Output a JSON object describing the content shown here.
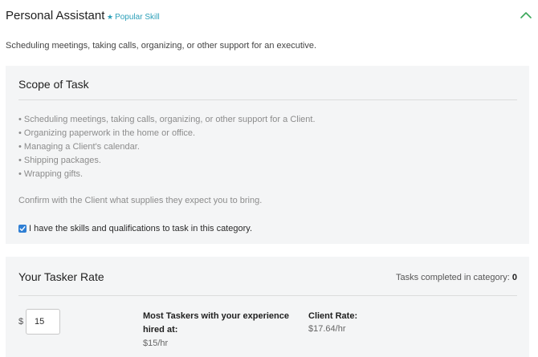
{
  "header": {
    "title": "Personal Assistant",
    "popular_star": "★",
    "popular_label": "Popular Skill",
    "toggle_icon": "chevron-up-icon"
  },
  "description": "Scheduling meetings, taking calls, organizing, or other support for an executive.",
  "scope": {
    "title": "Scope of Task",
    "bullets": [
      "• Scheduling meetings, taking calls, organizing, or other support for a Client.",
      "• Organizing paperwork in the home or office.",
      "• Managing a Client's calendar.",
      "• Shipping packages.",
      "• Wrapping gifts."
    ],
    "confirm_text": "Confirm with the Client what supplies they expect you to bring.",
    "skills_checkbox": {
      "checked": true,
      "label": "I have the skills and qualifications to task in this category."
    }
  },
  "rate": {
    "title": "Your Tasker Rate",
    "tasks_completed_label": "Tasks completed in category:",
    "tasks_completed_count": "0",
    "currency_symbol": "$",
    "rate_value": "15",
    "most_taskers_label": "Most Taskers with your experience hired at:",
    "most_taskers_value": "$15/hr",
    "client_rate_label": "Client Rate:",
    "client_rate_value": "$17.64/hr"
  },
  "colors": {
    "accent_teal": "#2b9fb8",
    "chevron_green": "#3aa65a",
    "checkbox_blue": "#2f7fd4",
    "card_background": "#f4f5f6"
  }
}
